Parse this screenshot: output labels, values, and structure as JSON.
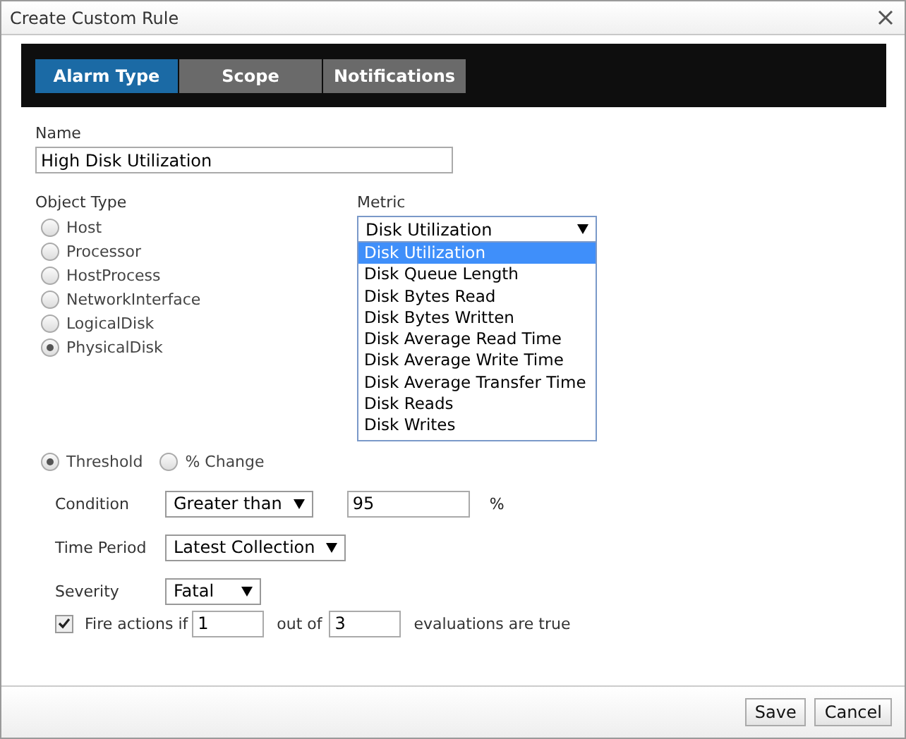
{
  "window": {
    "title": "Create Custom Rule"
  },
  "tabs": [
    {
      "label": "Alarm Type",
      "selected": true
    },
    {
      "label": "Scope",
      "selected": false
    },
    {
      "label": "Notifications",
      "selected": false
    }
  ],
  "name": {
    "label": "Name",
    "value": "High Disk Utilization"
  },
  "object_type": {
    "label": "Object Type",
    "options": [
      {
        "label": "Host",
        "selected": false
      },
      {
        "label": "Processor",
        "selected": false
      },
      {
        "label": "HostProcess",
        "selected": false
      },
      {
        "label": "NetworkInterface",
        "selected": false
      },
      {
        "label": "LogicalDisk",
        "selected": false
      },
      {
        "label": "PhysicalDisk",
        "selected": true
      }
    ]
  },
  "metric": {
    "label": "Metric",
    "value": "Disk Utilization",
    "expanded": true,
    "options": [
      {
        "label": "Disk Utilization",
        "selected": true
      },
      {
        "label": "Disk Queue Length",
        "selected": false
      },
      {
        "label": "Disk Bytes Read",
        "selected": false
      },
      {
        "label": "Disk Bytes Written",
        "selected": false
      },
      {
        "label": "Disk Average Read Time",
        "selected": false
      },
      {
        "label": "Disk Average Write Time",
        "selected": false
      },
      {
        "label": "Disk Average Transfer Time",
        "selected": false
      },
      {
        "label": "Disk Reads",
        "selected": false
      },
      {
        "label": "Disk Writes",
        "selected": false
      }
    ]
  },
  "mode": [
    {
      "label": "Threshold",
      "selected": true
    },
    {
      "label": "% Change",
      "selected": false
    }
  ],
  "condition": {
    "label": "Condition",
    "value": "Greater than",
    "threshold": "95",
    "unit": "%"
  },
  "time_period": {
    "label": "Time Period",
    "value": "Latest Collection"
  },
  "severity": {
    "label": "Severity",
    "value": "Fatal"
  },
  "fire_actions": {
    "checked": true,
    "text_before": "Fire actions if",
    "count": "1",
    "text_middle": "out of",
    "total": "3",
    "text_after": "evaluations are true"
  },
  "buttons": [
    "Save",
    "Cancel"
  ]
}
